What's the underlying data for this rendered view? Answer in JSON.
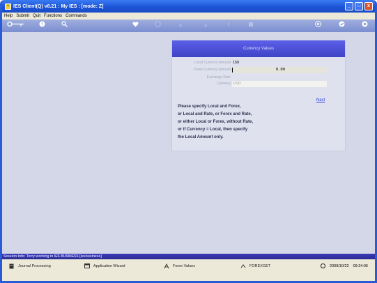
{
  "window": {
    "title": "IES Client(Q) v8.21 : My IES :        [mode: Z]",
    "controls": [
      "_",
      "□",
      "x"
    ]
  },
  "menu": [
    "Help",
    "Submit",
    "Quit",
    "Functions",
    "Commands"
  ],
  "toolbar": {
    "icons": [
      "key-icon",
      "help-icon",
      "search-icon",
      "heart-icon",
      "info-icon",
      "rewind-icon",
      "forward-icon",
      "upload-icon",
      "stop-icon",
      "scroll-icon",
      "check-icon",
      "close-icon"
    ],
    "rewind_glyph": "«",
    "forward_glyph": "»"
  },
  "panel": {
    "title": "Currency Values",
    "fields": {
      "local_amount_label": "Local Currency Amount",
      "local_amount_value": "150",
      "forex_amount_label": "Forex Currency Amount",
      "forex_amount_value": "0.00",
      "exchange_rate_label": "Exchange Rate",
      "exchange_rate_value": "",
      "currency_label": "Currency",
      "currency_value": "USD"
    },
    "next_link": "Next",
    "info_text": "Please specify Local and Forex,\nor Local and Rate, or Forex and Rate,\nor either Local or Forex, without Rate,\nor if Currency = Local, then specify\nthe Local Amount only."
  },
  "session": {
    "text": "Session Info: Terry working in IES BUSINESS  [iesbusiness]"
  },
  "taskbar": {
    "journal": "Journal Processing",
    "wizard": "Application Wizard",
    "forex_values": "Forex Values",
    "forexget": "FOREXGET",
    "date": "2009/10/22",
    "time": "09:24:06"
  }
}
